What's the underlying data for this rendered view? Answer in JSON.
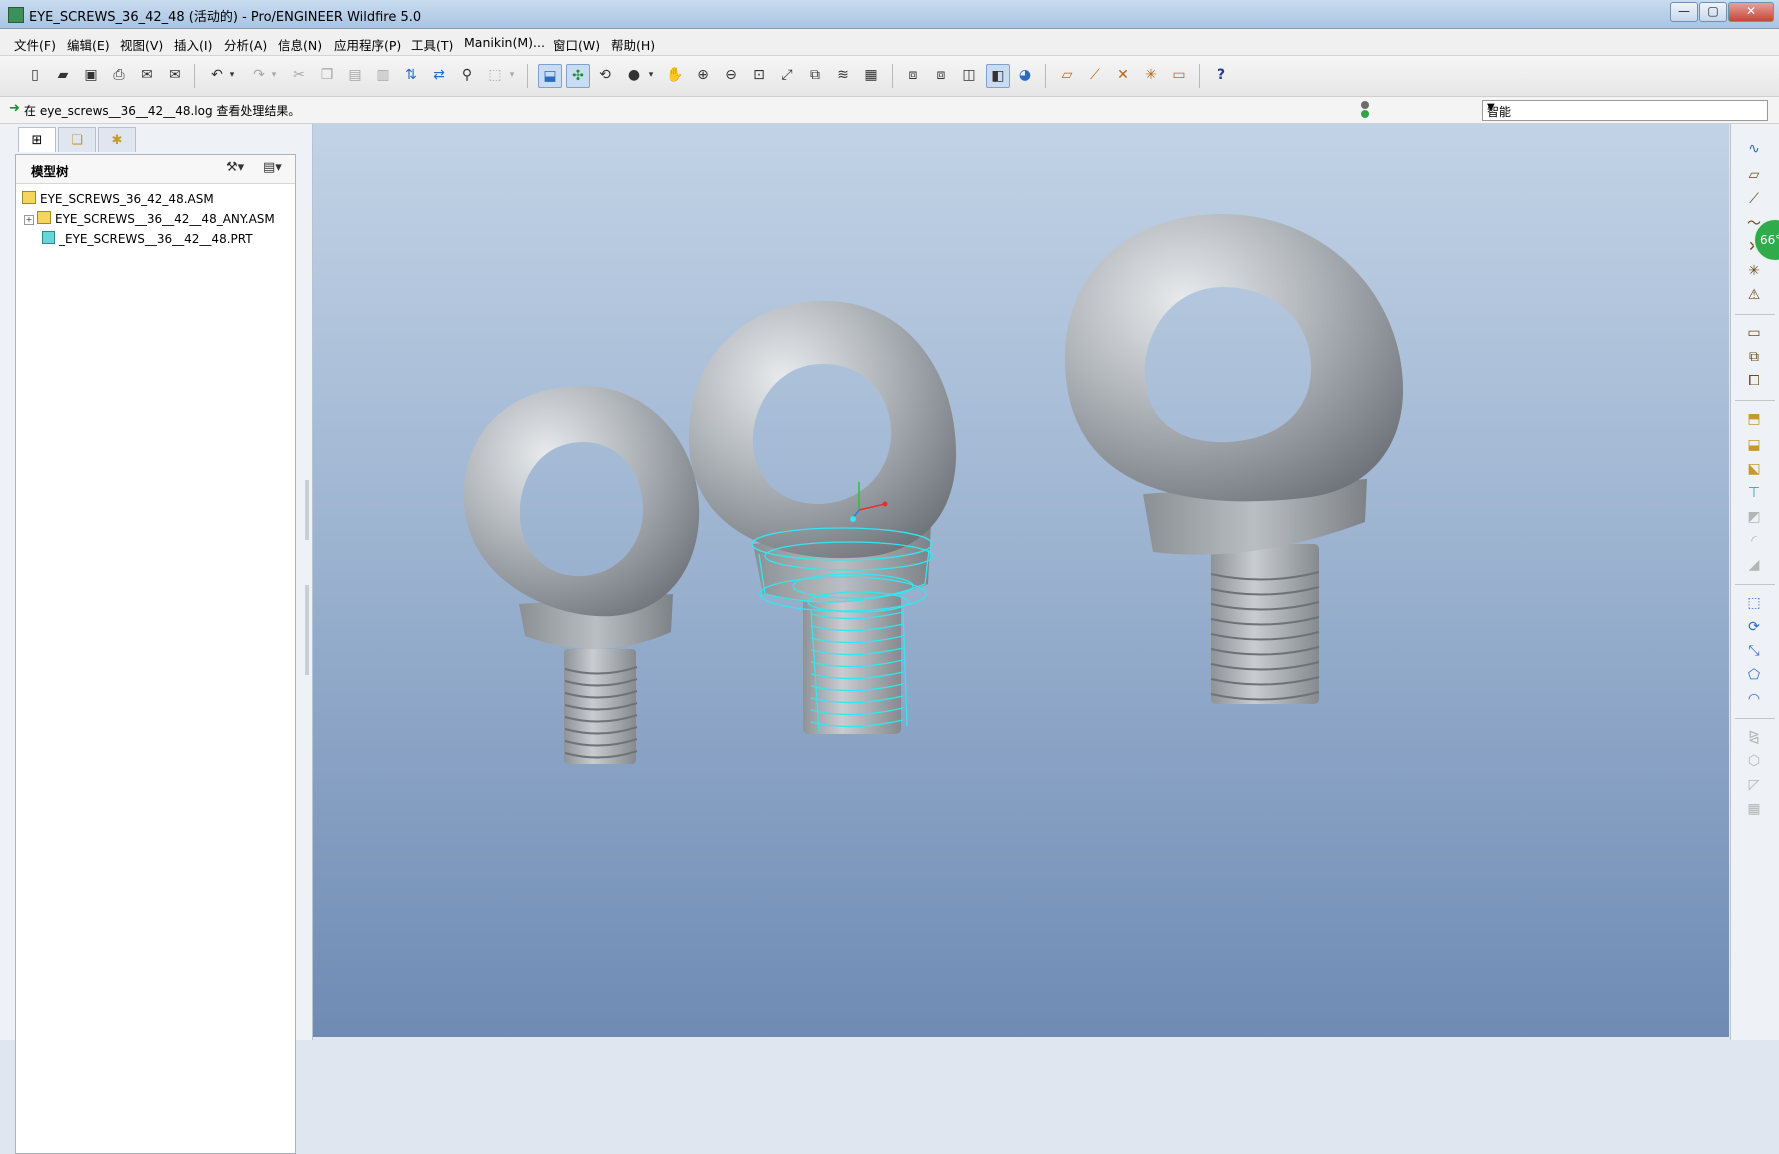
{
  "window": {
    "title": "EYE_SCREWS_36_42_48 (活动的) - Pro/ENGINEER Wildfire 5.0",
    "min_glyph": "—",
    "max_glyph": "▢",
    "close_glyph": "✕"
  },
  "menubar": {
    "items": [
      "文件(F)",
      "编辑(E)",
      "视图(V)",
      "插入(I)",
      "分析(A)",
      "信息(N)",
      "应用程序(P)",
      "工具(T)",
      "Manikin(M)...",
      "窗口(W)",
      "帮助(H)"
    ]
  },
  "toolbar": {
    "icons": [
      "new-icon",
      "open-icon",
      "save-icon",
      "print-icon",
      "email-icon",
      "email-link-icon",
      "undo-icon",
      "redo-icon",
      "cut-icon",
      "copy-icon",
      "paste-icon",
      "paste-special-icon",
      "regenerate-icon",
      "regen-manager-icon",
      "find-icon",
      "select-box-icon",
      "repaint-icon",
      "spin-center-icon",
      "orient-mode-icon",
      "appearance-icon",
      "pan-icon",
      "zoom-in-icon",
      "zoom-out-icon",
      "refit-icon",
      "reorient-icon",
      "saved-views-icon",
      "layers-icon",
      "view-manager-icon",
      "wireframe-icon",
      "hidden-line-icon",
      "no-hidden-icon",
      "shading-icon",
      "enhanced-realism-icon",
      "datum-planes-icon",
      "datum-axes-icon",
      "datum-points-icon",
      "coord-systems-icon",
      "annotations-icon",
      "context-help-icon"
    ],
    "help_glyph": "?"
  },
  "message": {
    "text": "在 eye_screws__36__42__48.log 查看处理结果。"
  },
  "filter": {
    "value": "智能"
  },
  "panel": {
    "title": "模型树",
    "tabs": [
      "model-tree-tab",
      "folder-browser-tab",
      "favorites-tab"
    ],
    "tree": [
      {
        "label": "EYE_SCREWS_36_42_48.ASM",
        "type": "asm",
        "level": 0
      },
      {
        "label": "EYE_SCREWS__36__42__48_ANY.ASM",
        "type": "asm",
        "level": 1,
        "expandable": true
      },
      {
        "label": "_EYE_SCREWS__36__42__48.PRT",
        "type": "prt",
        "level": 1
      }
    ]
  },
  "status_badge": {
    "text": "66°"
  },
  "colors": {
    "viewport_top": "#c2d3e6",
    "viewport_bottom": "#6f8bb4",
    "model_gray": "#a9aeb3",
    "highlight_cyan": "#33e6ef"
  }
}
